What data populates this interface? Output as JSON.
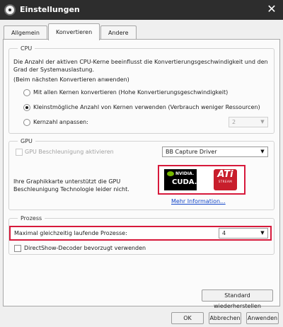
{
  "window": {
    "title": "Einstellungen"
  },
  "tabs": [
    {
      "label": "Allgemein"
    },
    {
      "label": "Konvertieren"
    },
    {
      "label": "Andere"
    }
  ],
  "active_tab": "Konvertieren",
  "cpu": {
    "legend": "CPU",
    "description": "Die Anzahl der aktiven CPU-Kerne beeinflusst die Konvertierungsgeschwindigkeit und den Grad der Systemauslastung.",
    "note": "(Beim nächsten Konvertieren anwenden)",
    "options": [
      {
        "label": "Mit allen Kernen konvertieren (Hohe Konvertierungsgeschwindigkeit)",
        "selected": false
      },
      {
        "label": "Kleinstmögliche Anzahl von Kernen verwenden (Verbrauch weniger Ressourcen)",
        "selected": true
      },
      {
        "label": "Kernzahl anpassen:",
        "selected": false
      }
    ],
    "core_count": "2"
  },
  "gpu": {
    "legend": "GPU",
    "checkbox_label": "GPU Beschleunigung aktivieren",
    "checkbox_checked": false,
    "driver": "BB Capture Driver",
    "info": "Ihre Graphikkarte unterstützt die GPU Beschleunigung Technologie leider nicht.",
    "logos": {
      "nvidia_brand": "NVIDIA.",
      "nvidia_product": "CUDA.",
      "ati_brand": "ATi",
      "ati_sub": "STREAM"
    },
    "more_info_link": "Mehr Information..."
  },
  "process": {
    "legend": "Prozess",
    "max_label": "Maximal gleichzeitig laufende Prozesse:",
    "max_value": "4",
    "directshow_label": "DirectShow-Decoder bevorzugt verwenden",
    "directshow_checked": false
  },
  "buttons": {
    "restore": "Standard wiederherstellen",
    "ok": "OK",
    "cancel": "Abbrechen",
    "apply": "Anwenden"
  },
  "colors": {
    "highlight": "#d7193b",
    "titlebar": "#2d2d2d",
    "link": "#1346c9",
    "ati": "#c81e2c",
    "nvidia_eye": "#76b900"
  }
}
